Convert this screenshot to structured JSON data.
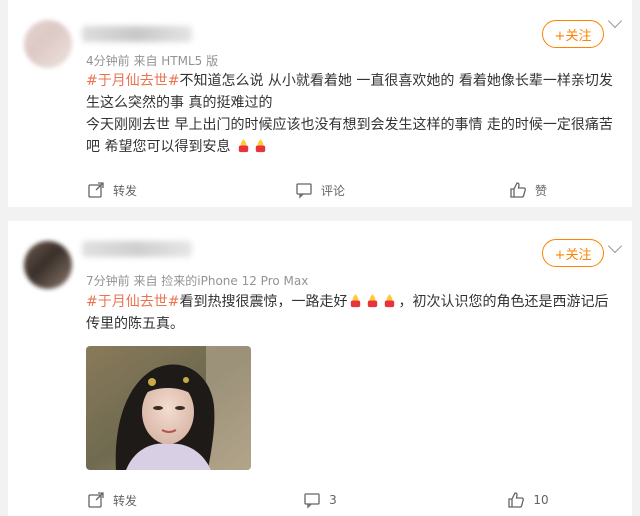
{
  "colors": {
    "accent": "#ff8200",
    "tag": "#eb7350",
    "meta": "#939393",
    "background": "#f2f2f2"
  },
  "posts": [
    {
      "meta": "4分钟前  来自 HTML5 版",
      "follow_label": "+关注",
      "hashtag": "#于月仙去世#",
      "text_line1": "不知道怎么说 从小就看着她 一直很喜欢她的 看着她像长辈一样亲切发生这么突然的事 真的挺难过的",
      "text_line2": "今天刚刚去世 早上出门的时候应该也没有想到会发生这样的事情 走的时候一定很痛苦吧 希望您可以得到安息",
      "emoji": "candle-emoji",
      "actions": {
        "repost": "转发",
        "comment": "评论",
        "like": "赞"
      }
    },
    {
      "meta": "7分钟前  来自 捡来的iPhone 12 Pro Max",
      "follow_label": "+关注",
      "hashtag": "#于月仙去世#",
      "text_a": "看到热搜很震惊，一路走好",
      "text_b": "，初次认识您的角色还是西游记后传里的陈五真。",
      "emoji": "candle-emoji",
      "actions": {
        "repost": "转发",
        "comment": "3",
        "like": "10"
      }
    }
  ]
}
